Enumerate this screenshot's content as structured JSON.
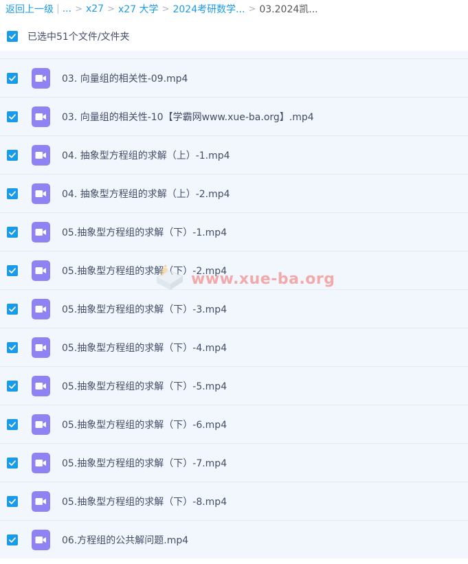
{
  "breadcrumb": {
    "back": "返回上一级",
    "ellipsis": "...",
    "items": [
      "x27",
      "x27 大学",
      "2024考研数学..."
    ],
    "current": "03.2024凯..."
  },
  "selection": {
    "label": "已选中51个文件/文件夹",
    "checked": true
  },
  "files": [
    {
      "name": "03. 向量组的相关性-09.mp4",
      "checked": true,
      "icon": "video-file-icon"
    },
    {
      "name": "03. 向量组的相关性-10【学霸网www.xue-ba.org】.mp4",
      "checked": true,
      "icon": "video-file-icon"
    },
    {
      "name": "04. 抽象型方程组的求解（上）-1.mp4",
      "checked": true,
      "icon": "video-file-icon"
    },
    {
      "name": "04. 抽象型方程组的求解（上）-2.mp4",
      "checked": true,
      "icon": "video-file-icon"
    },
    {
      "name": "05.抽象型方程组的求解（下）-1.mp4",
      "checked": true,
      "icon": "video-file-icon"
    },
    {
      "name": "05.抽象型方程组的求解（下）-2.mp4",
      "checked": true,
      "icon": "video-file-icon"
    },
    {
      "name": "05.抽象型方程组的求解（下）-3.mp4",
      "checked": true,
      "icon": "video-file-icon"
    },
    {
      "name": "05.抽象型方程组的求解（下）-4.mp4",
      "checked": true,
      "icon": "video-file-icon"
    },
    {
      "name": "05.抽象型方程组的求解（下）-5.mp4",
      "checked": true,
      "icon": "video-file-icon"
    },
    {
      "name": "05.抽象型方程组的求解（下）-6.mp4",
      "checked": true,
      "icon": "video-file-icon"
    },
    {
      "name": "05.抽象型方程组的求解（下）-7.mp4",
      "checked": true,
      "icon": "video-file-icon"
    },
    {
      "name": "05.抽象型方程组的求解（下）-8.mp4",
      "checked": true,
      "icon": "video-file-icon"
    },
    {
      "name": "06.方程组的公共解问题.mp4",
      "checked": true,
      "icon": "video-file-icon"
    }
  ],
  "watermark": {
    "text": "www.xue-ba.org"
  },
  "colors": {
    "accent": "#1a9be8",
    "video_icon": "#8f82f3",
    "list_background": "#f2f7fd",
    "watermark": "#f2a9a9"
  }
}
